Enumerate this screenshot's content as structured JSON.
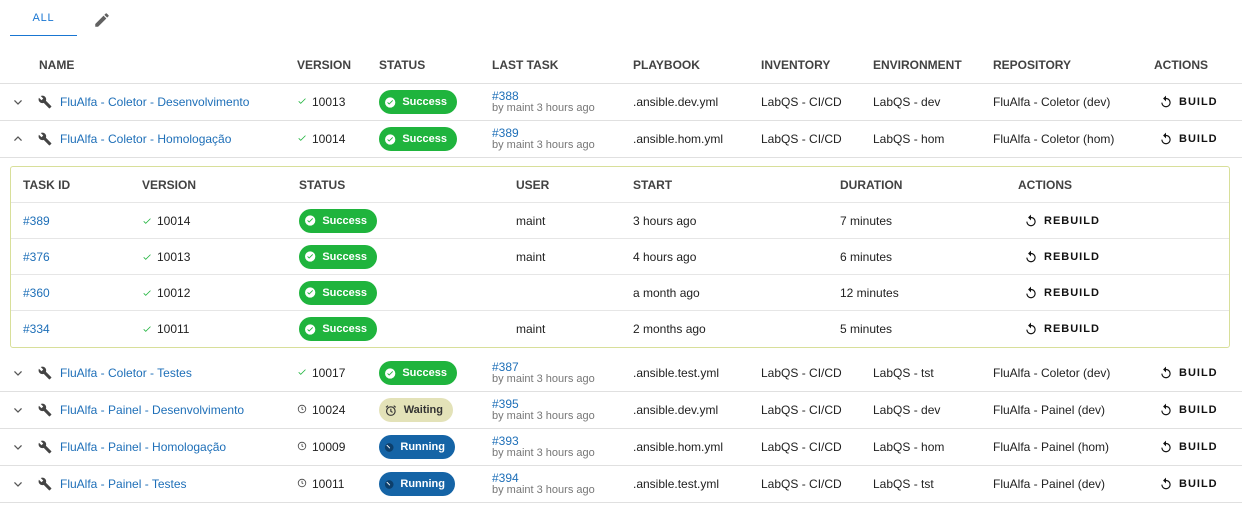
{
  "tabs": {
    "all": "ALL"
  },
  "headers": {
    "name": "NAME",
    "version": "VERSION",
    "status": "STATUS",
    "last_task": "LAST TASK",
    "playbook": "PLAYBOOK",
    "inventory": "INVENTORY",
    "environment": "ENVIRONMENT",
    "repository": "REPOSITORY",
    "actions": "ACTIONS"
  },
  "build_label": "BUILD",
  "rows": [
    {
      "name": "FluAlfa - Coletor - Desenvolvimento",
      "version": "10013",
      "status": "Success",
      "task": "#388",
      "by": "by maint 3 hours ago",
      "playbook": ".ansible.dev.yml",
      "inventory": "LabQS - CI/CD",
      "environment": "LabQS - dev",
      "repository": "FluAlfa - Coletor (dev)"
    },
    {
      "name": "FluAlfa - Coletor - Homologação",
      "version": "10014",
      "status": "Success",
      "task": "#389",
      "by": "by maint 3 hours ago",
      "playbook": ".ansible.hom.yml",
      "inventory": "LabQS - CI/CD",
      "environment": "LabQS - hom",
      "repository": "FluAlfa - Coletor (hom)"
    },
    {
      "name": "FluAlfa - Coletor - Testes",
      "version": "10017",
      "status": "Success",
      "task": "#387",
      "by": "by maint 3 hours ago",
      "playbook": ".ansible.test.yml",
      "inventory": "LabQS - CI/CD",
      "environment": "LabQS - tst",
      "repository": "FluAlfa - Coletor (dev)"
    },
    {
      "name": "FluAlfa - Painel - Desenvolvimento",
      "version": "10024",
      "status": "Waiting",
      "task": "#395",
      "by": "by maint 3 hours ago",
      "playbook": ".ansible.dev.yml",
      "inventory": "LabQS - CI/CD",
      "environment": "LabQS - dev",
      "repository": "FluAlfa - Painel (dev)"
    },
    {
      "name": "FluAlfa - Painel - Homologação",
      "version": "10009",
      "status": "Running",
      "task": "#393",
      "by": "by maint 3 hours ago",
      "playbook": ".ansible.hom.yml",
      "inventory": "LabQS - CI/CD",
      "environment": "LabQS - hom",
      "repository": "FluAlfa - Painel (hom)"
    },
    {
      "name": "FluAlfa - Painel - Testes",
      "version": "10011",
      "status": "Running",
      "task": "#394",
      "by": "by maint 3 hours ago",
      "playbook": ".ansible.test.yml",
      "inventory": "LabQS - CI/CD",
      "environment": "LabQS - tst",
      "repository": "FluAlfa - Painel (dev)"
    }
  ],
  "history": {
    "headers": {
      "task_id": "TASK ID",
      "version": "VERSION",
      "status": "STATUS",
      "user": "USER",
      "start": "START",
      "duration": "DURATION",
      "actions": "ACTIONS"
    },
    "rebuild_label": "REBUILD",
    "rows": [
      {
        "task_id": "#389",
        "version": "10014",
        "status": "Success",
        "user": "maint",
        "start": "3 hours ago",
        "duration": "7 minutes"
      },
      {
        "task_id": "#376",
        "version": "10013",
        "status": "Success",
        "user": "maint",
        "start": "4 hours ago",
        "duration": "6 minutes"
      },
      {
        "task_id": "#360",
        "version": "10012",
        "status": "Success",
        "user": "",
        "start": "a month ago",
        "duration": "12 minutes"
      },
      {
        "task_id": "#334",
        "version": "10011",
        "status": "Success",
        "user": "maint",
        "start": "2 months ago",
        "duration": "5 minutes"
      }
    ]
  },
  "colors": {
    "accent": "#1976d2",
    "success": "#1fb43d",
    "waiting": "#e3e2b8",
    "running": "#1564a6",
    "link": "#1e6fb8",
    "expanded_border": "#d8df9a"
  }
}
